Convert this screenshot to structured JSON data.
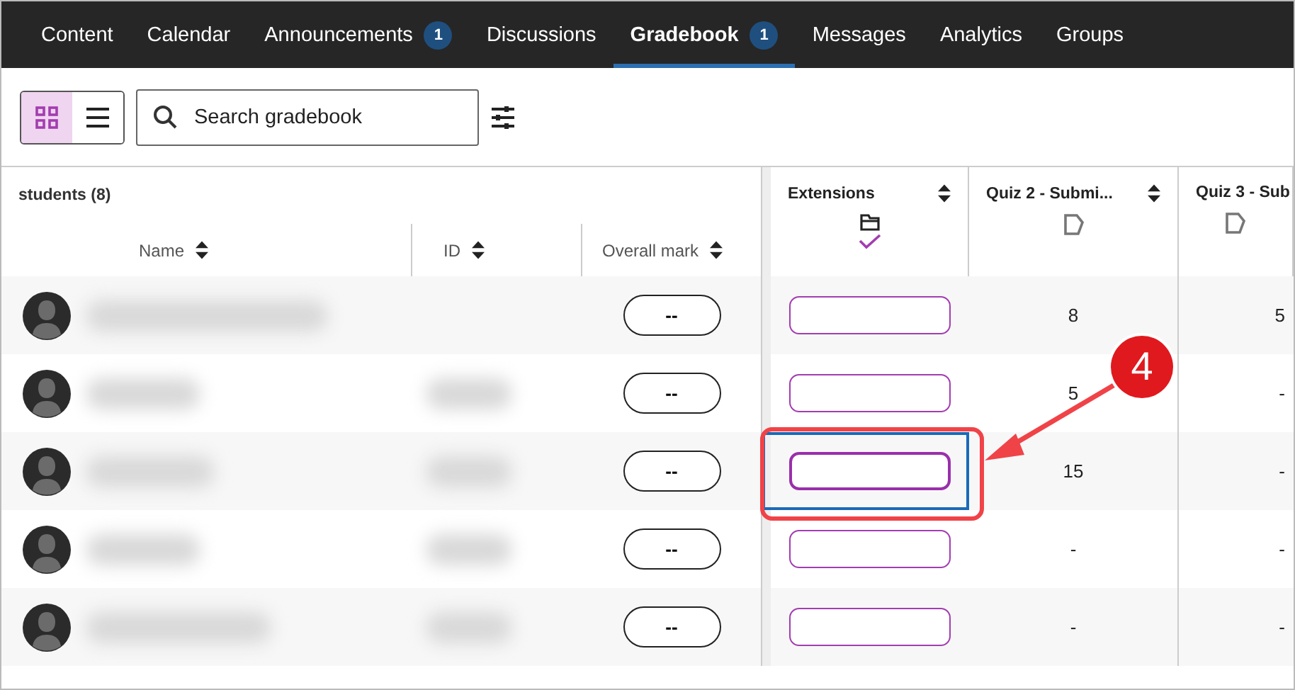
{
  "nav_tabs": [
    {
      "label": "Content",
      "selected": false
    },
    {
      "label": "Calendar",
      "selected": false
    },
    {
      "label": "Announcements",
      "badge": "1",
      "selected": false
    },
    {
      "label": "Discussions",
      "selected": false
    },
    {
      "label": "Gradebook",
      "badge": "1",
      "selected": true
    },
    {
      "label": "Messages",
      "selected": false
    },
    {
      "label": "Analytics",
      "selected": false
    },
    {
      "label": "Groups",
      "selected": false
    }
  ],
  "toolbar": {
    "views": [
      {
        "kind": "grid",
        "selected": true
      },
      {
        "kind": "list",
        "selected": false
      }
    ],
    "search": {
      "placeholder": "Search gradebook"
    }
  },
  "table": {
    "group_title": "students (8)",
    "columns": [
      {
        "kind": "name",
        "label": "Name"
      },
      {
        "kind": "id",
        "label": "ID"
      },
      {
        "kind": "mark",
        "label": "Overall mark"
      }
    ],
    "grade_columns": [
      {
        "kind": "extensions",
        "label": "Extensions",
        "checked": true
      },
      {
        "kind": "quiz",
        "label": "Quiz 2 - Submi..."
      },
      {
        "kind": "quiz",
        "label": "Quiz 3 - Sub"
      }
    ],
    "rows": [
      {
        "mark": "--",
        "extension_focused": false,
        "quiz_2": "8",
        "quiz_3": "5"
      },
      {
        "mark": "--",
        "extension_focused": false,
        "quiz_2": "5",
        "quiz_3": "-"
      },
      {
        "mark": "--",
        "extension_focused": true,
        "quiz_2": "15",
        "quiz_3": "-"
      },
      {
        "mark": "--",
        "extension_focused": false,
        "quiz_2": "-",
        "quiz_3": "-"
      },
      {
        "mark": "--",
        "extension_focused": false,
        "quiz_2": "-",
        "quiz_3": "-"
      }
    ]
  },
  "annotation": {
    "label": "4"
  }
}
